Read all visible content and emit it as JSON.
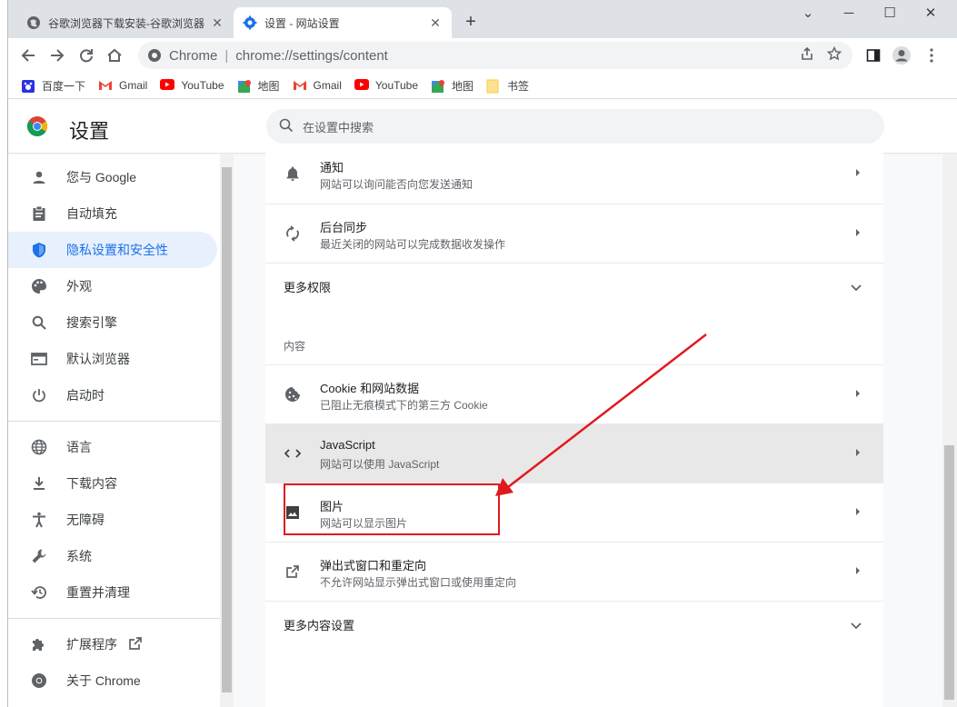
{
  "tabs": [
    {
      "title": "谷歌浏览器下载安装-谷歌浏览器",
      "close": "✕"
    },
    {
      "title": "设置 - 网站设置",
      "close": "✕"
    }
  ],
  "new_tab": "+",
  "window_controls": {
    "chevron": "⌄",
    "minimize": "─",
    "maximize": "☐",
    "close": "✕"
  },
  "omnibox": {
    "scheme_label": "Chrome",
    "separator": "|",
    "url": "chrome://settings/content"
  },
  "bookmarks": [
    {
      "label": "百度一下",
      "icon": "baidu-icon"
    },
    {
      "label": "Gmail",
      "icon": "gmail-icon"
    },
    {
      "label": "YouTube",
      "icon": "youtube-icon"
    },
    {
      "label": "地图",
      "icon": "maps-icon"
    },
    {
      "label": "Gmail",
      "icon": "gmail-icon"
    },
    {
      "label": "YouTube",
      "icon": "youtube-icon"
    },
    {
      "label": "地图",
      "icon": "maps-icon"
    },
    {
      "label": "书签",
      "icon": "folder-icon"
    }
  ],
  "settings": {
    "title": "设置",
    "search_placeholder": "在设置中搜索"
  },
  "sidebar": {
    "items": [
      {
        "label": "您与 Google",
        "icon": "person-icon"
      },
      {
        "label": "自动填充",
        "icon": "clipboard-icon"
      },
      {
        "label": "隐私设置和安全性",
        "icon": "shield-icon",
        "selected": true
      },
      {
        "label": "外观",
        "icon": "palette-icon"
      },
      {
        "label": "搜索引擎",
        "icon": "search-icon"
      },
      {
        "label": "默认浏览器",
        "icon": "browser-icon"
      },
      {
        "label": "启动时",
        "icon": "power-icon"
      },
      {
        "label": "语言",
        "icon": "globe-icon"
      },
      {
        "label": "下载内容",
        "icon": "download-icon"
      },
      {
        "label": "无障碍",
        "icon": "accessibility-icon"
      },
      {
        "label": "系统",
        "icon": "wrench-icon"
      },
      {
        "label": "重置并清理",
        "icon": "restore-icon"
      },
      {
        "label": "扩展程序",
        "icon": "puzzle-icon"
      },
      {
        "label": "关于 Chrome",
        "icon": "chrome-icon"
      }
    ]
  },
  "content": {
    "rows_top": [
      {
        "title": "通知",
        "subtitle": "网站可以询问能否向您发送通知",
        "icon": "bell-icon"
      },
      {
        "title": "后台同步",
        "subtitle": "最近关闭的网站可以完成数据收发操作",
        "icon": "sync-icon"
      }
    ],
    "more_permissions": "更多权限",
    "section_label": "内容",
    "rows_content": [
      {
        "title": "Cookie 和网站数据",
        "subtitle": "已阻止无痕模式下的第三方 Cookie",
        "icon": "cookie-icon"
      },
      {
        "title": "JavaScript",
        "subtitle": "网站可以使用 JavaScript",
        "icon": "code-icon"
      },
      {
        "title": "图片",
        "subtitle": "网站可以显示图片",
        "icon": "image-icon"
      },
      {
        "title": "弹出式窗口和重定向",
        "subtitle": "不允许网站显示弹出式窗口或使用重定向",
        "icon": "open-in-new-icon"
      }
    ],
    "more_content": "更多内容设置"
  },
  "colors": {
    "accent": "#1a73e8",
    "highlight_red": "#e0191f",
    "selected_bg": "#e8f0fe"
  }
}
